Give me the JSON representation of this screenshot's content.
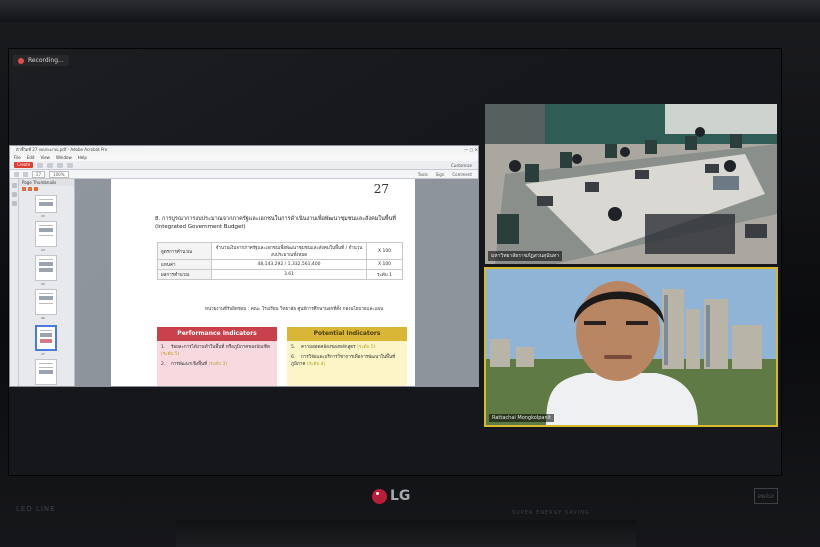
{
  "recording": {
    "label": "Recording..."
  },
  "pdf": {
    "window_title": "ตัวชี้วัดที่ 27 งบประมาณ.pdf - Adobe Acrobat Pro",
    "menu": [
      "File",
      "Edit",
      "View",
      "Window",
      "Help"
    ],
    "toolbar": {
      "create_label": "Create",
      "customize_label": "Customize",
      "right_tabs": [
        "Tools",
        "Sign",
        "Comment"
      ]
    },
    "nav": {
      "page_field": "27",
      "zoom": "100%"
    },
    "thumbnail_panel": {
      "title": "Page Thumbnails",
      "pages": [
        "23",
        "24",
        "25",
        "26",
        "27",
        "28"
      ],
      "selected": "27"
    },
    "page": {
      "number": "27",
      "heading": "8. การบูรณาการงบประมาณจากภาครัฐและเอกชนในการดำเนินงานเพื่อพัฒนาชุมชนและสังคมในพื้นที่ (Integrated Government Budget)",
      "formula": {
        "rows": [
          {
            "label": "สูตรการคำนวณ",
            "value": "จำนวนเงินจากภาครัฐและเอกชนเพื่อพัฒนาชุมชนและสังคมในพื้นที่ / จำนวนงบประมาณทั้งหมด",
            "mult": "X 100"
          },
          {
            "label": "แทนค่า",
            "value": "48,143,292 / 1,332,561,400",
            "mult": "X 100"
          },
          {
            "label": "ผลการคำนวณ",
            "value": "3.61",
            "mult": "ระดับ 1"
          }
        ]
      },
      "responsible": "หน่วยงานที่รับผิดชอบ : คณะ โรงเรียน วิทยาลัย ศูนย์การศึกษานอกที่ตั้ง กองนโยบายและแผน",
      "performance": {
        "title": "Performance Indicators",
        "items": [
          {
            "num": "1.",
            "text": "ร้อยละการได้งานทำในพื้นที่ หรือภูมิภาคของบัณฑิต",
            "level": "(ระดับ 5)"
          },
          {
            "num": "2.",
            "text": "การพัฒนาเชิงพื้นที่",
            "level": "(ระดับ 3)"
          }
        ]
      },
      "potential": {
        "title": "Potential Indicators",
        "items": [
          {
            "num": "5.",
            "text": "ความสอดคล้องของหลักสูตร",
            "level": "(ระดับ 5)"
          },
          {
            "num": "6.",
            "text": "การวิจัยและบริการวิชาการเพื่อการพัฒนาในพื้นที่ภูมิภาค",
            "level": "(ระดับ 4)"
          }
        ]
      }
    }
  },
  "video": {
    "room_label": "มหาวิทยาลัยราชภัฏสวนสุนันทา",
    "speaker_label": "Rattachai Mongkolpanit"
  },
  "monitor": {
    "brand": "LG",
    "model": "LED LINE",
    "features": "SUPER ENERGY SAVING",
    "cert": "ENERGY"
  },
  "colors": {
    "performance": "#c8414b",
    "potential": "#d9b636",
    "active_speaker": "#d6b92c"
  }
}
